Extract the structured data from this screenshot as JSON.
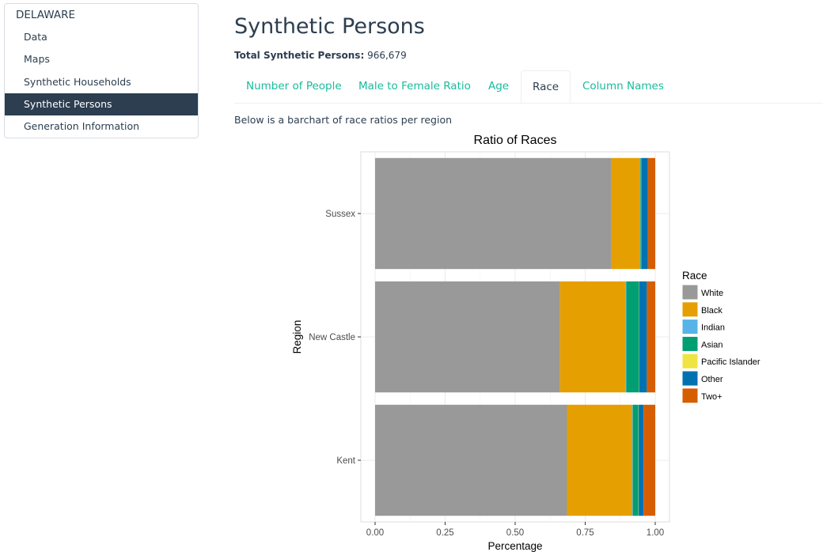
{
  "sidebar": {
    "header": "DELAWARE",
    "items": [
      {
        "label": "Data"
      },
      {
        "label": "Maps"
      },
      {
        "label": "Synthetic Households"
      },
      {
        "label": "Synthetic Persons"
      },
      {
        "label": "Generation Information"
      }
    ],
    "active_index": 3
  },
  "main": {
    "title": "Synthetic Persons",
    "total_label": "Total Synthetic Persons:",
    "total_value": "966,679",
    "tabs": [
      {
        "label": "Number of People"
      },
      {
        "label": "Male to Female Ratio"
      },
      {
        "label": "Age"
      },
      {
        "label": "Race"
      },
      {
        "label": "Column Names"
      }
    ],
    "active_tab": "Race",
    "description": "Below is a barchart of race ratios per region"
  },
  "colors": {
    "accent": "#18bc9c",
    "dark": "#2c3e50"
  },
  "chart_data": {
    "type": "bar",
    "orientation": "horizontal",
    "stacked": true,
    "title": "Ratio of Races",
    "xlabel": "Percentage",
    "ylabel": "Region",
    "xlim": [
      0,
      1
    ],
    "xticks": [
      "0.00",
      "0.25",
      "0.50",
      "0.75",
      "1.00"
    ],
    "grid": true,
    "legend_title": "Race",
    "legend_position": "right",
    "categories": [
      "Sussex",
      "New Castle",
      "Kent"
    ],
    "series": [
      {
        "name": "White",
        "color": "#999999",
        "values": [
          0.843,
          0.66,
          0.685
        ]
      },
      {
        "name": "Black",
        "color": "#E69F00",
        "values": [
          0.102,
          0.235,
          0.233
        ]
      },
      {
        "name": "Indian",
        "color": "#56B4E9",
        "values": [
          0.002,
          0.002,
          0.002
        ]
      },
      {
        "name": "Asian",
        "color": "#009E73",
        "values": [
          0.002,
          0.045,
          0.02
        ]
      },
      {
        "name": "Pacific Islander",
        "color": "#F0E442",
        "values": [
          0.001,
          0.001,
          0.001
        ]
      },
      {
        "name": "Other",
        "color": "#0072B2",
        "values": [
          0.024,
          0.027,
          0.017
        ]
      },
      {
        "name": "Two+",
        "color": "#D55E00",
        "values": [
          0.026,
          0.03,
          0.042
        ]
      }
    ]
  }
}
